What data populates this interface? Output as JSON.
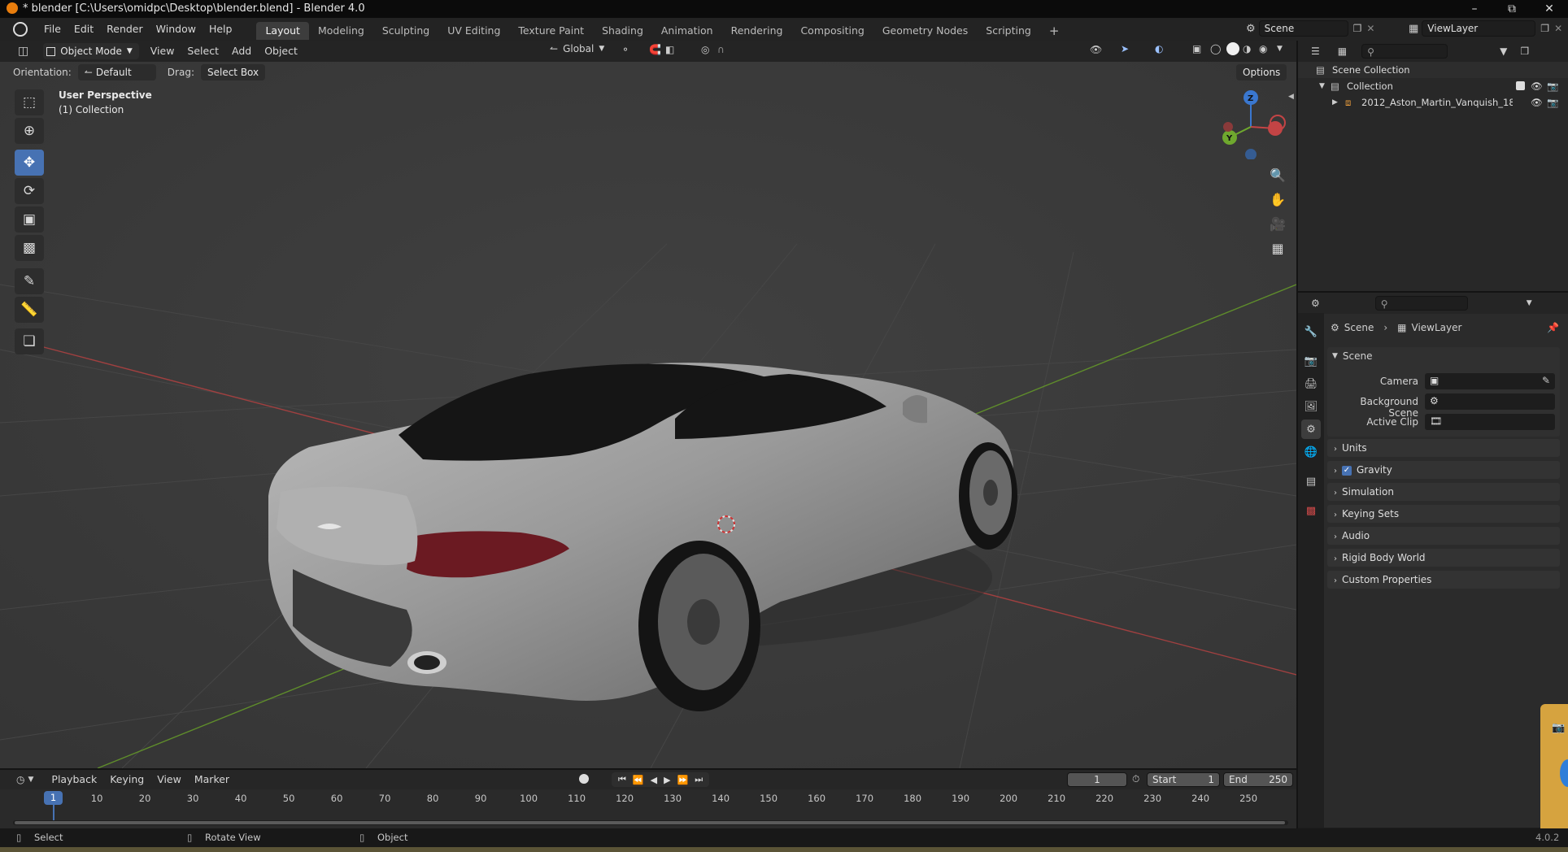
{
  "window": {
    "title": "* blender [C:\\Users\\omidpc\\Desktop\\blender.blend] - Blender 4.0"
  },
  "menu": [
    "File",
    "Edit",
    "Render",
    "Window",
    "Help"
  ],
  "workspaces": [
    {
      "label": "Layout",
      "active": true
    },
    {
      "label": "Modeling",
      "active": false
    },
    {
      "label": "Sculpting",
      "active": false
    },
    {
      "label": "UV Editing",
      "active": false
    },
    {
      "label": "Texture Paint",
      "active": false
    },
    {
      "label": "Shading",
      "active": false
    },
    {
      "label": "Animation",
      "active": false
    },
    {
      "label": "Rendering",
      "active": false
    },
    {
      "label": "Compositing",
      "active": false
    },
    {
      "label": "Geometry Nodes",
      "active": false
    },
    {
      "label": "Scripting",
      "active": false
    }
  ],
  "scene_selector": {
    "value": "Scene"
  },
  "viewlayer_selector": {
    "value": "ViewLayer"
  },
  "viewport_header": {
    "mode": "Object Mode",
    "menus": [
      "View",
      "Select",
      "Add",
      "Object"
    ],
    "transform_orientation": "Global"
  },
  "tool_settings": {
    "orientation_label": "Orientation:",
    "orientation_value": "Default",
    "drag_label": "Drag:",
    "drag_value": "Select Box",
    "options": "Options"
  },
  "viewport_overlay": {
    "view_name": "User Perspective",
    "collection_info": "(1) Collection"
  },
  "gizmo_axes": {
    "z": "Z",
    "y": "Y"
  },
  "outliner": {
    "rows": [
      {
        "label": "Scene Collection",
        "depth": 0
      },
      {
        "label": "Collection",
        "depth": 1
      },
      {
        "label": "2012_Aston_Martin_Vanquish_18€",
        "depth": 2
      }
    ]
  },
  "properties": {
    "breadcrumb": {
      "scene": "Scene",
      "viewlayer": "ViewLayer"
    },
    "scene_panel": "Scene",
    "fields": [
      {
        "label": "Camera"
      },
      {
        "label": "Background Scene"
      },
      {
        "label": "Active Clip"
      }
    ],
    "panels": [
      {
        "label": "Units"
      },
      {
        "label": "Gravity",
        "checked": true
      },
      {
        "label": "Simulation"
      },
      {
        "label": "Keying Sets"
      },
      {
        "label": "Audio"
      },
      {
        "label": "Rigid Body World"
      },
      {
        "label": "Custom Properties"
      }
    ]
  },
  "timeline": {
    "menus": [
      "Playback",
      "Keying",
      "View",
      "Marker"
    ],
    "current_frame": "1",
    "start_label": "Start",
    "start_value": "1",
    "end_label": "End",
    "end_value": "250",
    "ticks": [
      "10",
      "20",
      "30",
      "40",
      "50",
      "60",
      "70",
      "80",
      "90",
      "100",
      "110",
      "120",
      "130",
      "140",
      "150",
      "160",
      "170",
      "180",
      "190",
      "200",
      "210",
      "220",
      "230",
      "240",
      "250"
    ],
    "frame_indicator": "1"
  },
  "statusbar": {
    "items": [
      "Select",
      "Rotate View",
      "Object"
    ],
    "version": "4.0.2"
  },
  "colors": {
    "accent": "#4772b3",
    "axis_x": "#c34445",
    "axis_y": "#6fa82e",
    "axis_z": "#3a77cf"
  }
}
